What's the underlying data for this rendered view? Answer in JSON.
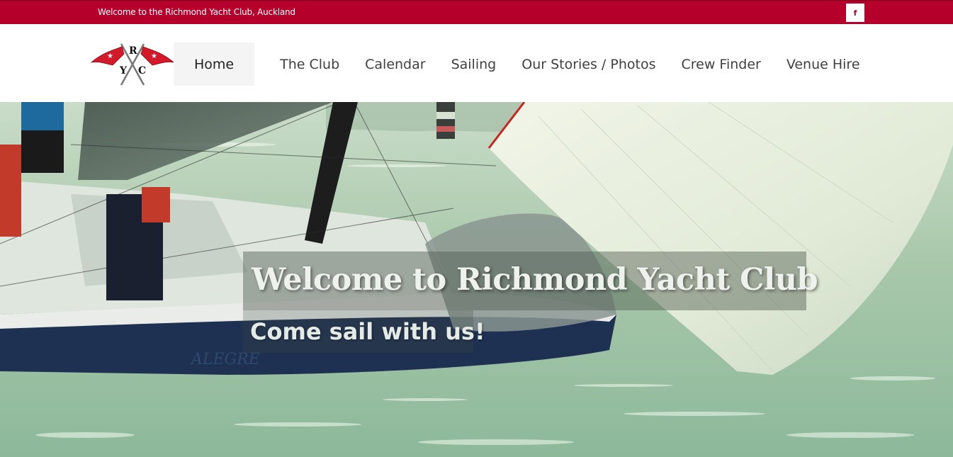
{
  "topbar": {
    "welcome_text": "Welcome to the Richmond Yacht Club, Auckland",
    "facebook_label": "f",
    "background_color": "#b5002b"
  },
  "logo": {
    "letter_r": "R",
    "letter_y": "Y",
    "letter_c": "C",
    "flag_color": "#d31a2a"
  },
  "nav": {
    "items": [
      {
        "label": "Home",
        "active": true
      },
      {
        "label": "The Club"
      },
      {
        "label": "Calendar"
      },
      {
        "label": "Sailing"
      },
      {
        "label": "Our Stories / Photos"
      },
      {
        "label": "Crew Finder"
      },
      {
        "label": "Venue Hire"
      }
    ]
  },
  "hero": {
    "title": "Welcome to Richmond Yacht Club",
    "subtitle": "Come sail with us!",
    "hull_text": "ALEGRE"
  }
}
